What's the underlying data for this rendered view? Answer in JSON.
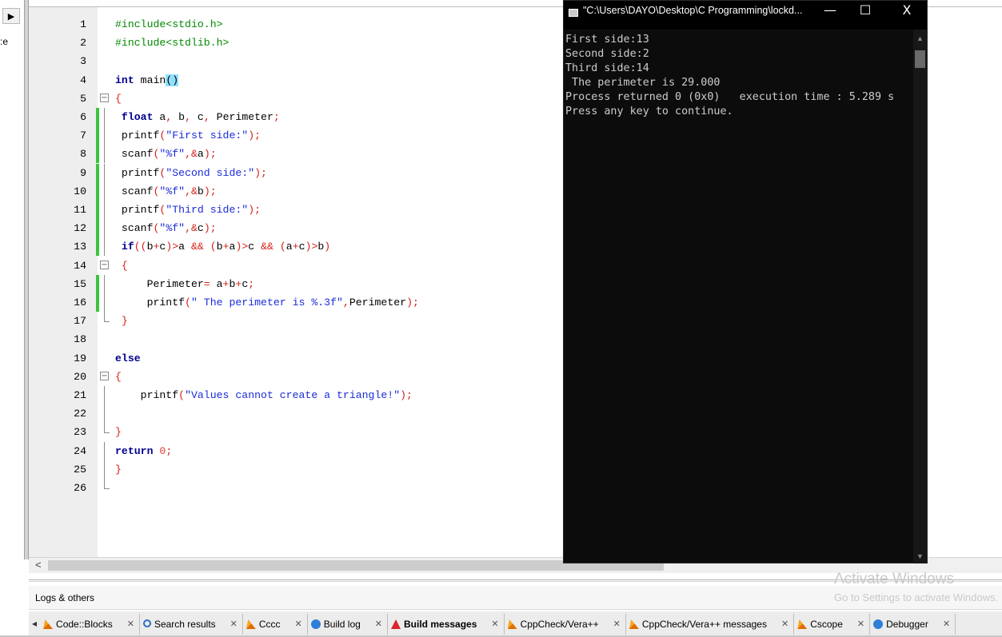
{
  "left_panel": {
    "clip_text": ":e",
    "arrow": "▶"
  },
  "editor": {
    "lines": [
      {
        "n": "1",
        "tokens": [
          [
            "pre",
            "#include<stdio.h>"
          ]
        ]
      },
      {
        "n": "2",
        "tokens": [
          [
            "pre",
            "#include<stdlib.h>"
          ]
        ]
      },
      {
        "n": "3",
        "tokens": []
      },
      {
        "n": "4",
        "tokens": [
          [
            "kw",
            "int"
          ],
          [
            "plain",
            " main"
          ],
          [
            "hl",
            "()"
          ]
        ]
      },
      {
        "n": "5",
        "tokens": [
          [
            "op",
            "{"
          ]
        ]
      },
      {
        "n": "6",
        "tokens": [
          [
            "plain",
            " "
          ],
          [
            "kw",
            "float"
          ],
          [
            "plain",
            " a"
          ],
          [
            "op",
            ","
          ],
          [
            "plain",
            " b"
          ],
          [
            "op",
            ","
          ],
          [
            "plain",
            " c"
          ],
          [
            "op",
            ","
          ],
          [
            "plain",
            " Perimeter"
          ],
          [
            "op",
            ";"
          ]
        ]
      },
      {
        "n": "7",
        "tokens": [
          [
            "plain",
            " printf"
          ],
          [
            "op",
            "("
          ],
          [
            "str",
            "\"First side:\""
          ],
          [
            "op",
            ");"
          ]
        ]
      },
      {
        "n": "8",
        "tokens": [
          [
            "plain",
            " scanf"
          ],
          [
            "op",
            "("
          ],
          [
            "str",
            "\"%f\""
          ],
          [
            "op",
            ",&"
          ],
          [
            "plain",
            "a"
          ],
          [
            "op",
            ");"
          ]
        ]
      },
      {
        "n": "9",
        "tokens": [
          [
            "plain",
            " printf"
          ],
          [
            "op",
            "("
          ],
          [
            "str",
            "\"Second side:\""
          ],
          [
            "op",
            ");"
          ]
        ]
      },
      {
        "n": "10",
        "tokens": [
          [
            "plain",
            " scanf"
          ],
          [
            "op",
            "("
          ],
          [
            "str",
            "\"%f\""
          ],
          [
            "op",
            ",&"
          ],
          [
            "plain",
            "b"
          ],
          [
            "op",
            ");"
          ]
        ]
      },
      {
        "n": "11",
        "tokens": [
          [
            "plain",
            " printf"
          ],
          [
            "op",
            "("
          ],
          [
            "str",
            "\"Third side:\""
          ],
          [
            "op",
            ");"
          ]
        ]
      },
      {
        "n": "12",
        "tokens": [
          [
            "plain",
            " scanf"
          ],
          [
            "op",
            "("
          ],
          [
            "str",
            "\"%f\""
          ],
          [
            "op",
            ",&"
          ],
          [
            "plain",
            "c"
          ],
          [
            "op",
            ");"
          ]
        ]
      },
      {
        "n": "13",
        "tokens": [
          [
            "plain",
            " "
          ],
          [
            "kw",
            "if"
          ],
          [
            "op",
            "(("
          ],
          [
            "plain",
            "b"
          ],
          [
            "op",
            "+"
          ],
          [
            "plain",
            "c"
          ],
          [
            "op",
            ")>"
          ],
          [
            "plain",
            "a "
          ],
          [
            "op",
            "&&"
          ],
          [
            "plain",
            " "
          ],
          [
            "op",
            "("
          ],
          [
            "plain",
            "b"
          ],
          [
            "op",
            "+"
          ],
          [
            "plain",
            "a"
          ],
          [
            "op",
            ")>"
          ],
          [
            "plain",
            "c "
          ],
          [
            "op",
            "&&"
          ],
          [
            "plain",
            " "
          ],
          [
            "op",
            "("
          ],
          [
            "plain",
            "a"
          ],
          [
            "op",
            "+"
          ],
          [
            "plain",
            "c"
          ],
          [
            "op",
            ")>"
          ],
          [
            "plain",
            "b"
          ],
          [
            "op",
            ")"
          ]
        ]
      },
      {
        "n": "14",
        "tokens": [
          [
            "plain",
            " "
          ],
          [
            "op",
            "{"
          ]
        ]
      },
      {
        "n": "15",
        "tokens": [
          [
            "plain",
            "     Perimeter"
          ],
          [
            "op",
            "="
          ],
          [
            "plain",
            " a"
          ],
          [
            "op",
            "+"
          ],
          [
            "plain",
            "b"
          ],
          [
            "op",
            "+"
          ],
          [
            "plain",
            "c"
          ],
          [
            "op",
            ";"
          ]
        ]
      },
      {
        "n": "16",
        "tokens": [
          [
            "plain",
            "     printf"
          ],
          [
            "op",
            "("
          ],
          [
            "str",
            "\" The perimeter is %.3f\""
          ],
          [
            "op",
            ","
          ],
          [
            "plain",
            "Perimeter"
          ],
          [
            "op",
            ");"
          ]
        ]
      },
      {
        "n": "17",
        "tokens": [
          [
            "plain",
            " "
          ],
          [
            "op",
            "}"
          ]
        ]
      },
      {
        "n": "18",
        "tokens": []
      },
      {
        "n": "19",
        "tokens": [
          [
            "kw",
            "else"
          ]
        ]
      },
      {
        "n": "20",
        "tokens": [
          [
            "op",
            "{"
          ]
        ]
      },
      {
        "n": "21",
        "tokens": [
          [
            "plain",
            "    printf"
          ],
          [
            "op",
            "("
          ],
          [
            "str",
            "\"Values cannot create a triangle!\""
          ],
          [
            "op",
            ");"
          ]
        ]
      },
      {
        "n": "22",
        "tokens": []
      },
      {
        "n": "23",
        "tokens": [
          [
            "op",
            "}"
          ]
        ]
      },
      {
        "n": "24",
        "tokens": [
          [
            "kw",
            "return"
          ],
          [
            "plain",
            " "
          ],
          [
            "num",
            "0"
          ],
          [
            "op",
            ";"
          ]
        ]
      },
      {
        "n": "25",
        "tokens": [
          [
            "op",
            "}"
          ]
        ]
      },
      {
        "n": "26",
        "tokens": []
      }
    ],
    "changed_lines": [
      "6",
      "7",
      "8",
      "9",
      "10",
      "11",
      "12",
      "13",
      "15",
      "16"
    ],
    "fold_boxes": [
      "5",
      "14",
      "20"
    ],
    "fold_ends": [
      "17",
      "23",
      "26"
    ]
  },
  "hscroll": {
    "left_arrow": "<"
  },
  "logs": {
    "title": "Logs & others",
    "left_arrow": "◂",
    "tabs": [
      {
        "label": "Code::Blocks",
        "icon": "codeblocks-icon"
      },
      {
        "label": "Search results",
        "icon": "search-icon"
      },
      {
        "label": "Cccc",
        "icon": "codeblocks-icon"
      },
      {
        "label": "Build log",
        "icon": "build-log-icon"
      },
      {
        "label": "Build messages",
        "icon": "build-messages-icon",
        "active": true
      },
      {
        "label": "CppCheck/Vera++",
        "icon": "codeblocks-icon"
      },
      {
        "label": "CppCheck/Vera++ messages",
        "icon": "codeblocks-icon"
      },
      {
        "label": "Cscope",
        "icon": "codeblocks-icon"
      },
      {
        "label": "Debugger",
        "icon": "build-log-icon"
      }
    ],
    "close_glyph": "✕"
  },
  "console": {
    "title": "\"C:\\Users\\DAYO\\Desktop\\C Programming\\lockd...",
    "minimize": "—",
    "maximize": "☐",
    "close": "X",
    "output": "First side:13\nSecond side:2\nThird side:14\n The perimeter is 29.000\nProcess returned 0 (0x0)   execution time : 5.289 s\nPress any key to continue.",
    "scroll_up": "▲",
    "scroll_down": "▼"
  },
  "watermark": {
    "title": "Activate Windows",
    "subtitle": "Go to Settings to activate Windows."
  },
  "colors": {
    "changed_marker": "#3cc43c",
    "keyword": "#000090",
    "string": "#1a2bd8",
    "preprocessor": "#008a00",
    "console_bg": "#0c0c0c"
  }
}
